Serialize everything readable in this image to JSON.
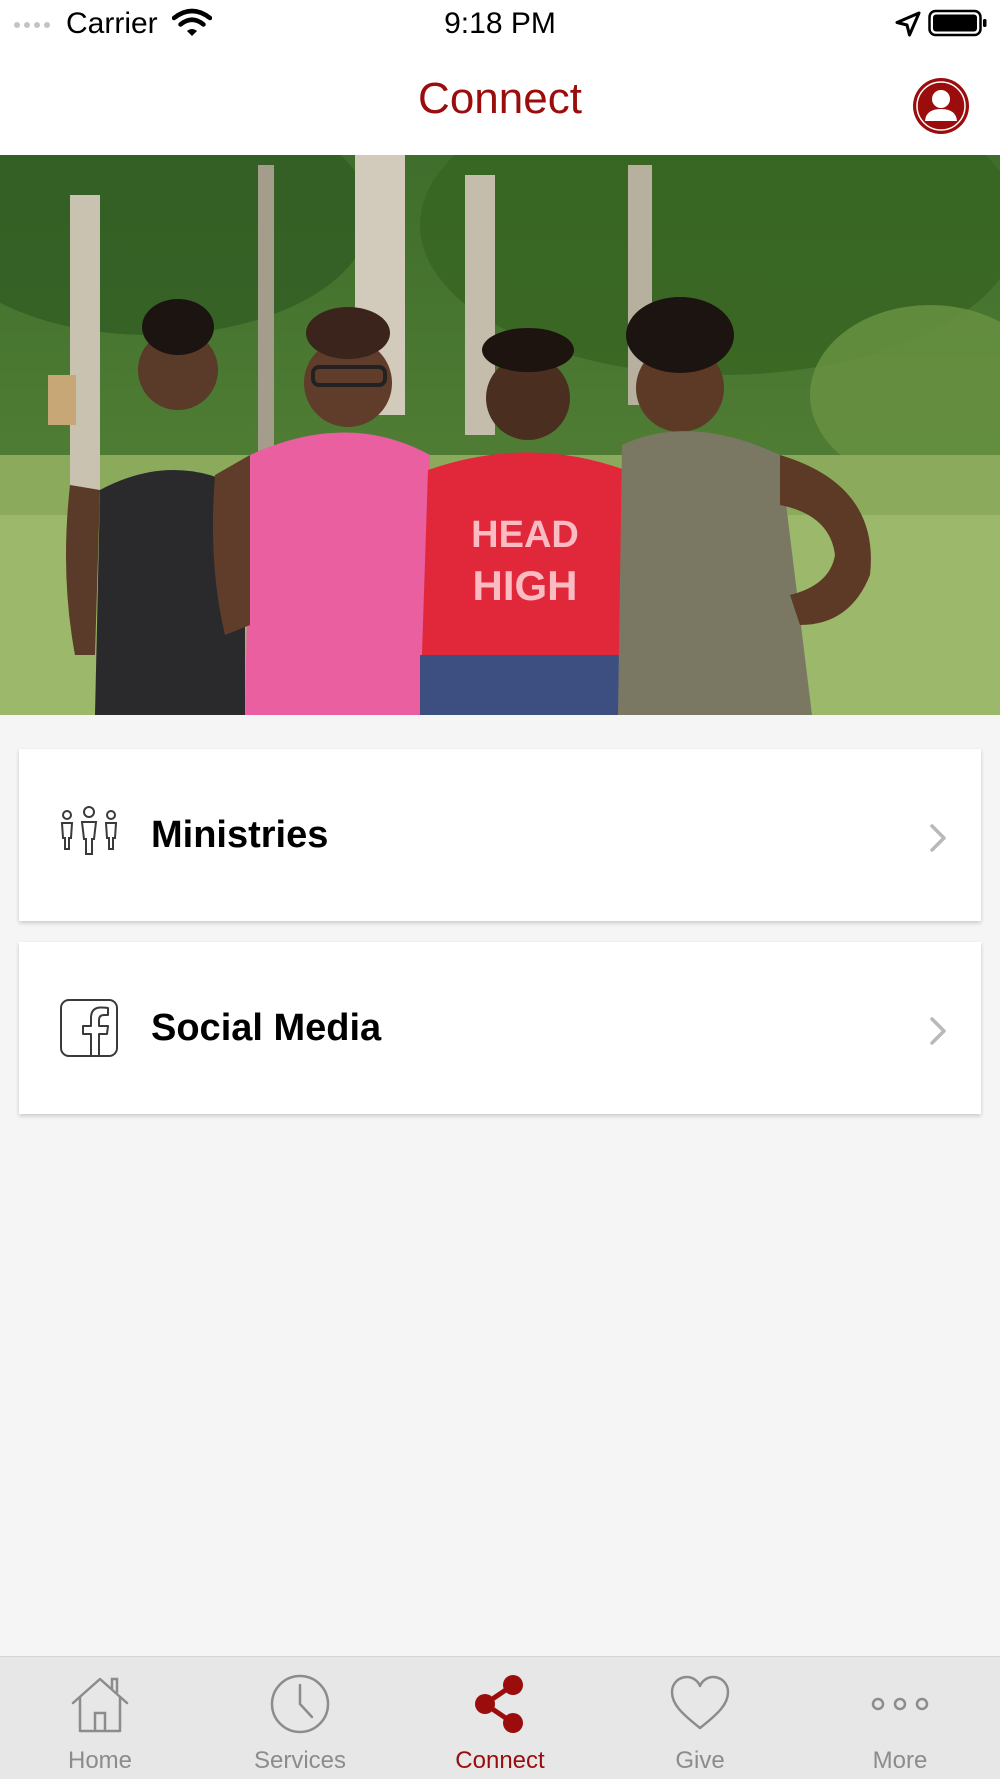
{
  "status_bar": {
    "carrier": "Carrier",
    "time": "9:18 PM"
  },
  "header": {
    "title": "Connect",
    "profile_icon": "user-icon"
  },
  "hero": {
    "icon": "photo"
  },
  "cards": [
    {
      "label": "Ministries",
      "icon": "people-icon"
    },
    {
      "label": "Social Media",
      "icon": "facebook-icon"
    }
  ],
  "tabs": [
    {
      "label": "Home",
      "icon": "house-icon"
    },
    {
      "label": "Services",
      "icon": "clock-icon"
    },
    {
      "label": "Connect",
      "icon": "share-icon",
      "active": true
    },
    {
      "label": "Give",
      "icon": "heart-icon"
    },
    {
      "label": "More",
      "icon": "more-dots-icon"
    }
  ],
  "colors": {
    "accent": "#9b0d0d",
    "inactive": "#8c8c8c",
    "background": "#f5f5f5"
  }
}
